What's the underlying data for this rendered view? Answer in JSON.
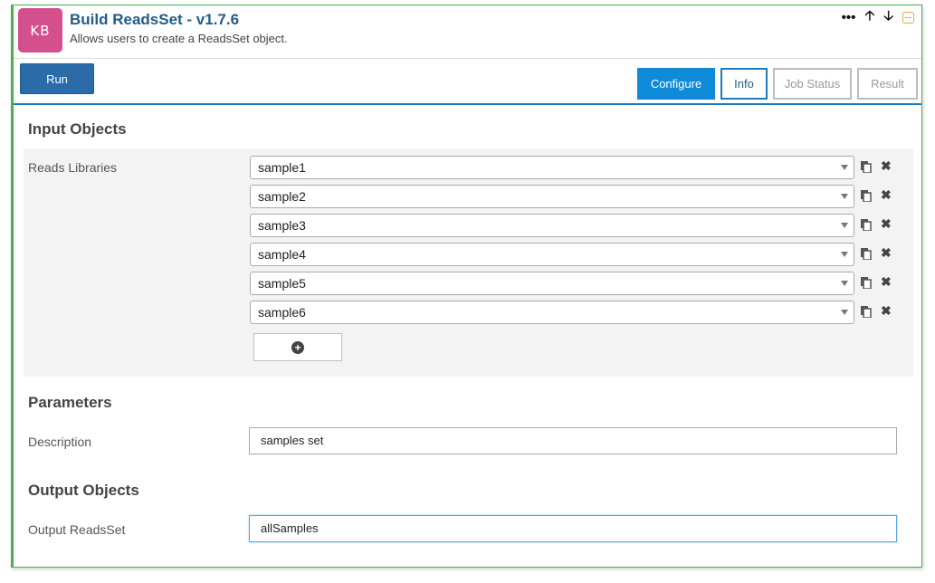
{
  "app": {
    "logo_text": "KB",
    "title": "Build ReadsSet - v1.7.6",
    "subtitle": "Allows users to create a ReadsSet object."
  },
  "header_tools": {
    "more": "•••",
    "up": "🡡",
    "down": "🡣"
  },
  "toolbar": {
    "run_label": "Run",
    "tabs": [
      {
        "label": "Configure",
        "state": "active"
      },
      {
        "label": "Info",
        "state": "normal"
      },
      {
        "label": "Job Status",
        "state": "disabled"
      },
      {
        "label": "Result",
        "state": "disabled"
      }
    ]
  },
  "input_objects": {
    "section_title": "Input Objects",
    "reads_libraries_label": "Reads Libraries",
    "selected": [
      "sample1",
      "sample2",
      "sample3",
      "sample4",
      "sample5",
      "sample6"
    ]
  },
  "parameters": {
    "section_title": "Parameters",
    "description_label": "Description",
    "description_value": "samples set"
  },
  "output_objects": {
    "section_title": "Output Objects",
    "output_label": "Output ReadsSet",
    "output_value": "allSamples"
  },
  "colors": {
    "brand": "#d3508c",
    "accent": "#0f8ad8",
    "run_button": "#2b6ca8",
    "cell_border": "#4caf50"
  }
}
